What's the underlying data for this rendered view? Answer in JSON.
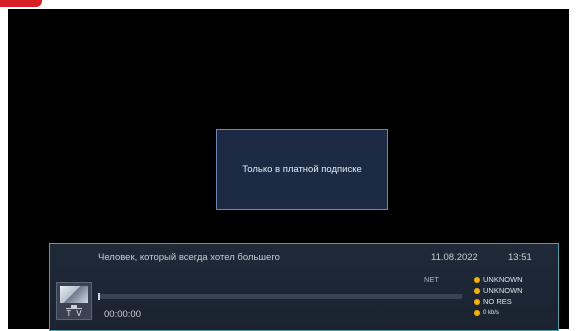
{
  "popup": {
    "message": "Только в платной подписке"
  },
  "infobar": {
    "program_title": "Человек, который всегда хотел большего",
    "date": "11.08.2022",
    "time": "13:51",
    "net_label": "NET",
    "elapsed": "00:00:00",
    "progress_percent": 0,
    "channel_logo": {
      "icon": "tv-icon",
      "text": "TV"
    },
    "status": [
      {
        "label": "UNKNOWN",
        "color": "#f5b10b"
      },
      {
        "label": "UNKNOWN",
        "color": "#f5b10b"
      },
      {
        "label": "NO RES",
        "color": "#f5b10b"
      },
      {
        "label": "0 kb/s",
        "color": "#f5b10b"
      }
    ]
  }
}
